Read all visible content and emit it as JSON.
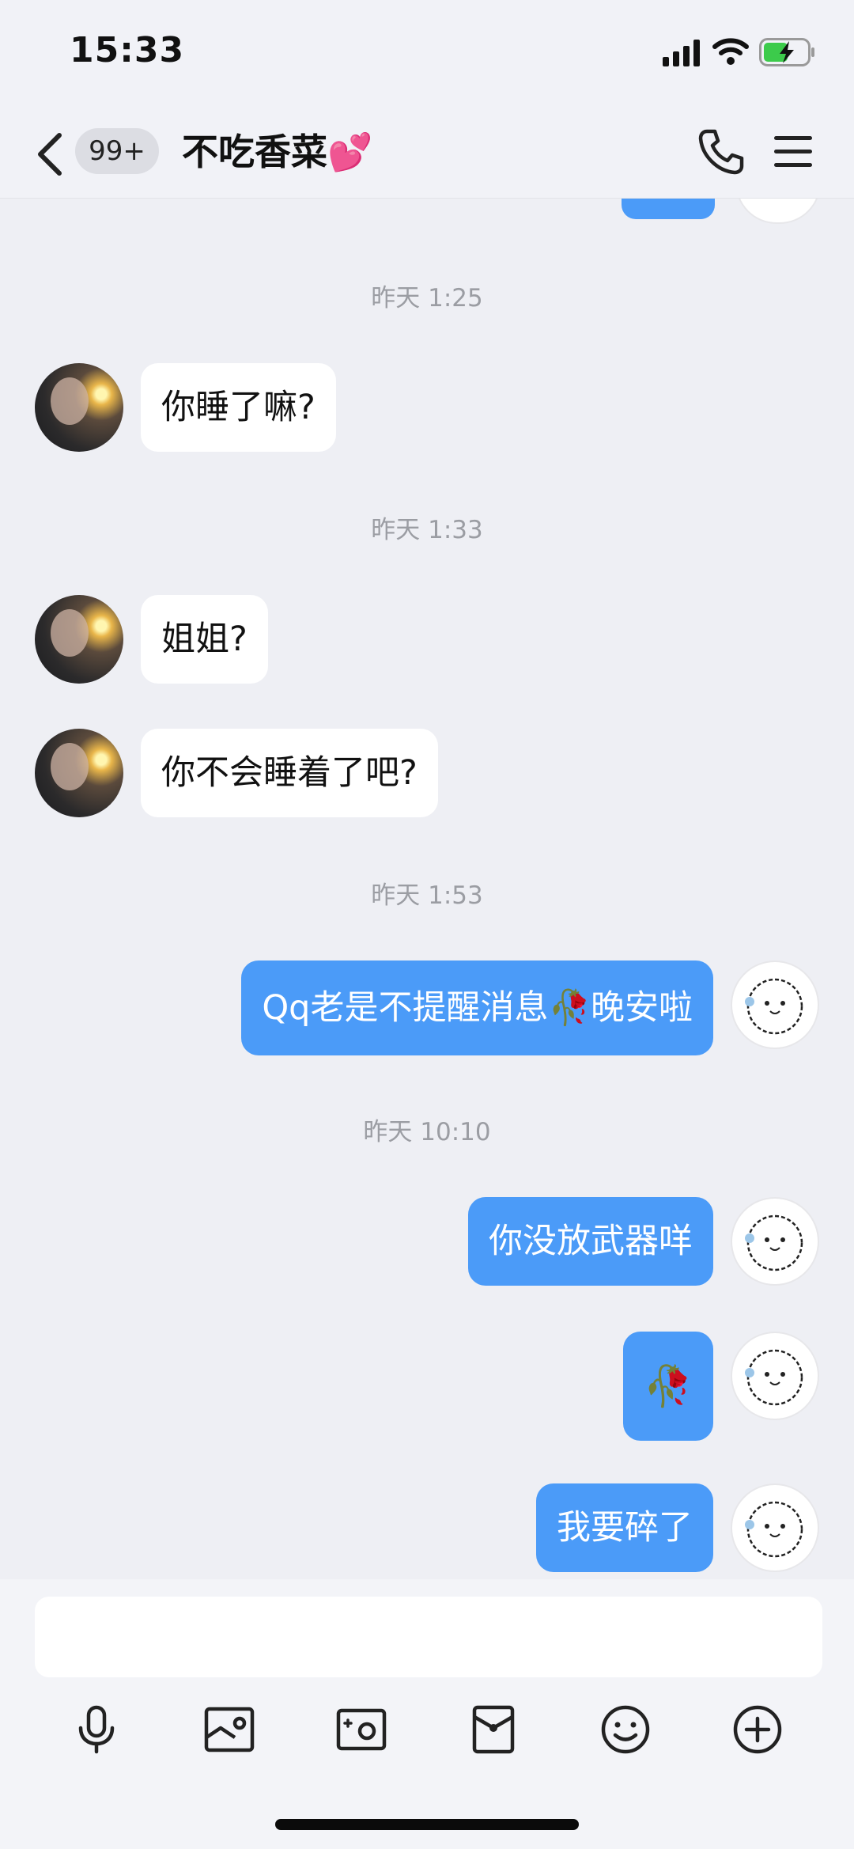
{
  "status_bar": {
    "time": "15:33"
  },
  "header": {
    "unread_count": "99+",
    "title": "不吃香菜💕"
  },
  "messages": [
    {
      "type": "timestamp",
      "text": "昨天 1:25"
    },
    {
      "type": "incoming",
      "text": "你睡了嘛?"
    },
    {
      "type": "timestamp",
      "text": "昨天 1:33"
    },
    {
      "type": "incoming",
      "text": "姐姐?"
    },
    {
      "type": "incoming",
      "text": "你不会睡着了吧?"
    },
    {
      "type": "timestamp",
      "text": "昨天 1:53"
    },
    {
      "type": "outgoing",
      "text": "Qq老是不提醒消息🥀晚安啦"
    },
    {
      "type": "timestamp",
      "text": "昨天 10:10"
    },
    {
      "type": "outgoing",
      "text": "你没放武器咩"
    },
    {
      "type": "outgoing",
      "text": "🥀"
    },
    {
      "type": "outgoing",
      "text": "我要碎了"
    }
  ],
  "input": {
    "placeholder": ""
  },
  "toolbar": [
    "microphone-icon",
    "image-icon",
    "camera-icon",
    "red-packet-icon",
    "emoji-icon",
    "plus-icon"
  ],
  "colors": {
    "accent_bubble": "#4b9bf8",
    "incoming_bubble": "#ffffff",
    "background": "#eeeff4"
  }
}
